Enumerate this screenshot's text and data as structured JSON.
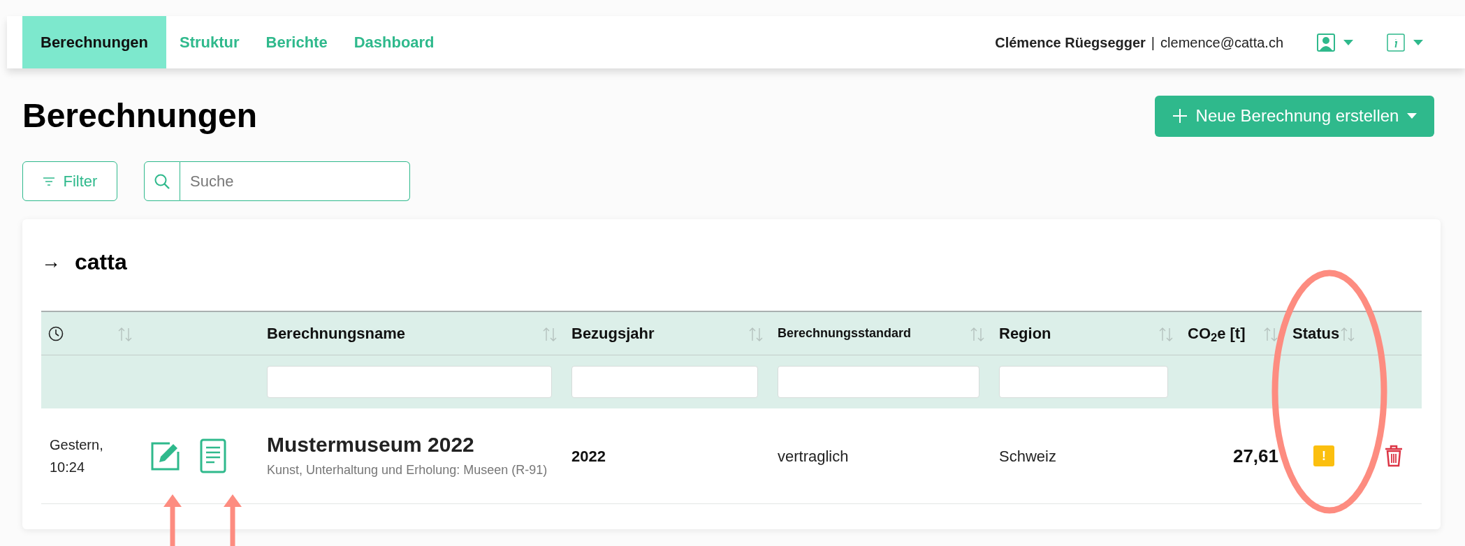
{
  "nav": {
    "tabs": [
      {
        "label": "Berechnungen",
        "selected": true
      },
      {
        "label": "Struktur",
        "selected": false
      },
      {
        "label": "Berichte",
        "selected": false
      },
      {
        "label": "Dashboard",
        "selected": false
      }
    ],
    "user_name": "Clémence Rüegsegger",
    "separator": "|",
    "user_email": "clemence@catta.ch"
  },
  "page_title": "Berechnungen",
  "new_button": {
    "label": "Neue Berechnung erstellen"
  },
  "filter_button": {
    "label": "Filter"
  },
  "search": {
    "placeholder": "Suche"
  },
  "group": {
    "arrow": "→",
    "name": "catta"
  },
  "table": {
    "columns": [
      {
        "kind": "clock",
        "sortable": true
      },
      {
        "kind": "actions"
      },
      {
        "kind": "text",
        "label": "Berechnungsname",
        "sortable": true,
        "filter": true
      },
      {
        "kind": "text",
        "label": "Bezugsjahr",
        "sortable": true,
        "filter": true
      },
      {
        "kind": "small",
        "label": "Berechnungsstandard",
        "sortable": true,
        "filter": true
      },
      {
        "kind": "text",
        "label": "Region",
        "sortable": true,
        "filter": true
      },
      {
        "kind": "text",
        "label": "CO$_{2}$e [t]",
        "sortable": true
      },
      {
        "kind": "text",
        "label": "Status",
        "sortable": true
      },
      {
        "kind": "delete"
      }
    ],
    "rows": [
      {
        "time": "Gestern, 10:24",
        "name": "Mustermuseum 2022",
        "category": "Kunst, Unterhaltung und Erholung: Museen (R-91)",
        "year": "2022",
        "standard": "vertraglich",
        "region": "Schweiz",
        "co2": "27,61",
        "status": {
          "kind": "warning",
          "symbol": "!"
        }
      }
    ]
  },
  "annotations": [
    {
      "kind": "ellipse"
    },
    {
      "kind": "arrow"
    },
    {
      "kind": "arrow"
    }
  ]
}
